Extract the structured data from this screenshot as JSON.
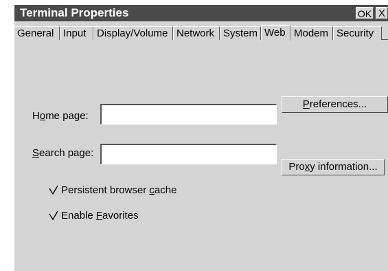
{
  "window": {
    "title": "Terminal Properties",
    "ok_label": "OK",
    "close_label": "X"
  },
  "tabs": [
    {
      "label": "General",
      "active": false
    },
    {
      "label": "Input",
      "active": false
    },
    {
      "label": "Display/Volume",
      "active": false
    },
    {
      "label": "Network",
      "active": false
    },
    {
      "label": "System",
      "active": false
    },
    {
      "label": "Web",
      "active": true
    },
    {
      "label": "Modem",
      "active": false
    },
    {
      "label": "Security",
      "active": false
    }
  ],
  "web": {
    "home_page": {
      "label_pre": "H",
      "label_mnemonic": "o",
      "label_post": "me page:",
      "value": ""
    },
    "search_page": {
      "label_pre": "",
      "label_mnemonic": "S",
      "label_post": "earch page:",
      "value": ""
    },
    "preferences_button": {
      "label_pre": "",
      "label_mnemonic": "P",
      "label_post": "references..."
    },
    "proxy_button": {
      "label_pre": "Pro",
      "label_mnemonic": "x",
      "label_post": "y information..."
    },
    "persistent_cache": {
      "checked": true,
      "label_pre": "Persistent browser ",
      "label_mnemonic": "c",
      "label_post": "ache"
    },
    "enable_favorites": {
      "checked": true,
      "label_pre": "Enable ",
      "label_mnemonic": "F",
      "label_post": "avorites"
    }
  }
}
